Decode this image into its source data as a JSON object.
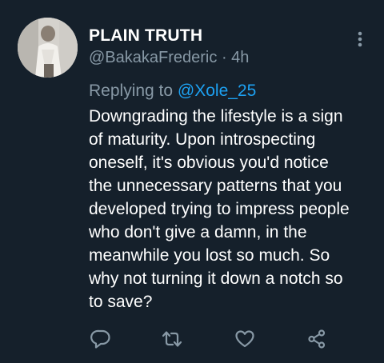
{
  "tweet": {
    "author": {
      "display_name": "PLAIN TRUTH",
      "handle": "@BakakaFrederic",
      "separator": "·",
      "time": "4h"
    },
    "reply_to": {
      "prefix": "Replying to",
      "handle": "@Xole_25"
    },
    "text_lines": [
      "Downgrading the lifestyle is a sign",
      "of maturity. Upon introspecting",
      "oneself, it's obvious you'd notice",
      "the unnecessary patterns that you",
      "developed trying to impress people",
      "who don't give a damn, in the",
      "meanwhile you lost so much. So",
      "why not turning it down a notch so",
      "to save?"
    ],
    "icons": {
      "more": "more-vertical-icon",
      "reply": "reply-icon",
      "retweet": "retweet-icon",
      "like": "like-icon",
      "share": "share-icon"
    }
  },
  "theme": {
    "background": "#15202b",
    "primary_text": "#ffffff",
    "secondary_text": "#8899a6",
    "accent": "#1da1f2"
  }
}
